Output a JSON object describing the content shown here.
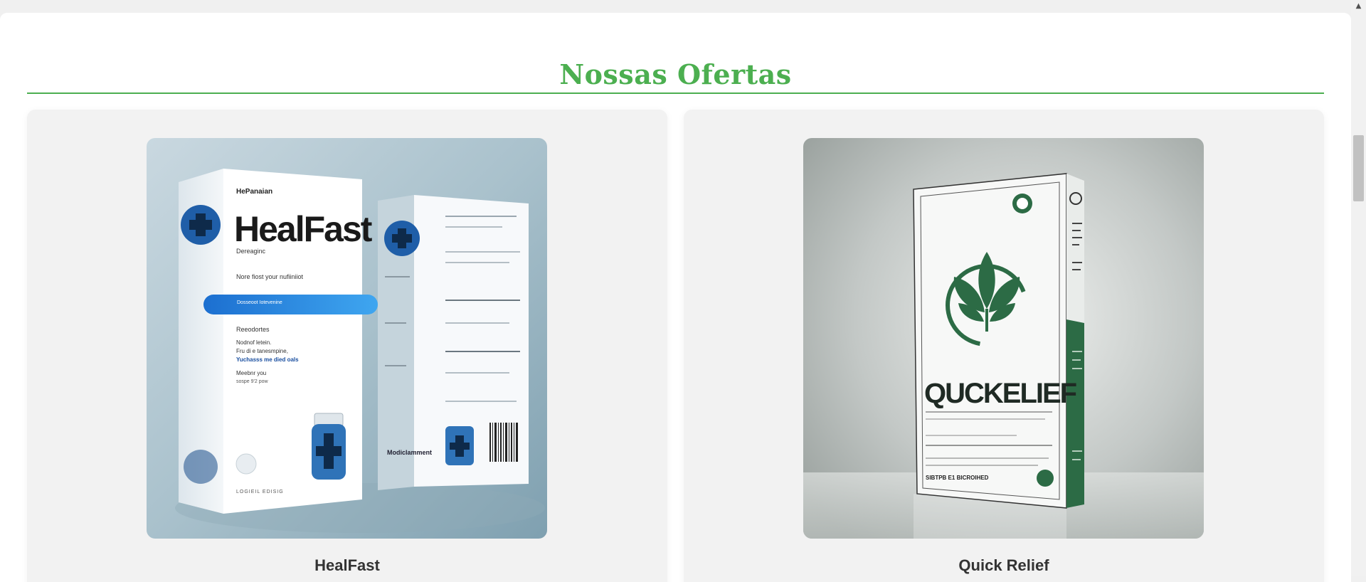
{
  "section": {
    "title": "Nossas Ofertas"
  },
  "colors": {
    "accent": "#4caf50",
    "card_bg": "#f2f2f2",
    "page_bg": "#ffffff"
  },
  "products": [
    {
      "name": "HealFast",
      "image": {
        "brand_text": "HealFast",
        "maker_text": "HePanaian",
        "sub_text": "Dereaginc",
        "tagline": "Nore fiost your nufiiniiot",
        "banner_text": "Dosseoot Iotevenine",
        "list_title": "Reeodortes",
        "list_line1": "Nodnof letein.",
        "list_line2": "Fru di e tanesmpine,",
        "list_line3": "Yuchasss me died oals",
        "list_line4": "Meebnr you",
        "list_line5": "sospe 9'2 pow",
        "footer_text": "LOGIEIL EDISIG",
        "side_box_text": "Modiclamment"
      }
    },
    {
      "name": "Quick Relief",
      "image": {
        "brand_text": "QUCKELIEF",
        "footer_text": "SIBTPB E1 BICROIHED"
      }
    }
  ],
  "scrollbar": {
    "up_arrow": "▲"
  }
}
